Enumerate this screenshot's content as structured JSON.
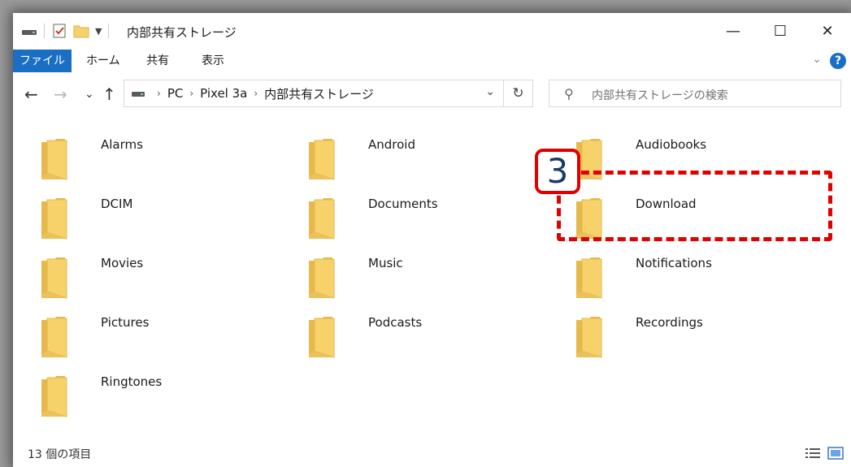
{
  "window": {
    "title": "内部共有ストレージ",
    "controls": {
      "minimize_icon": "—",
      "maximize_icon": "☐",
      "close_icon": "✕"
    }
  },
  "ribbon": {
    "tabs": [
      {
        "label": "ファイル",
        "active": true
      },
      {
        "label": "ホーム"
      },
      {
        "label": "共有"
      },
      {
        "label": "表示"
      }
    ],
    "help_label": "?",
    "accent_color": "#1a6fc4"
  },
  "nav": {
    "back_icon": "←",
    "forward_icon": "→",
    "recent_icon": "⌄",
    "up_icon": "↑",
    "breadcrumb": [
      "PC",
      "Pixel 3a",
      "内部共有ストレージ"
    ],
    "refresh_icon": "↻",
    "search_placeholder": "内部共有ストレージの検索"
  },
  "folders": [
    "Alarms",
    "Android",
    "Audiobooks",
    "DCIM",
    "Documents",
    "Download",
    "Movies",
    "Music",
    "Notifications",
    "Pictures",
    "Podcasts",
    "Recordings",
    "Ringtones"
  ],
  "folder_color": "#f7d26a",
  "status": {
    "item_count": "13 個の項目"
  },
  "annotation": {
    "number": "3",
    "target": "Download",
    "color": "#e00000"
  }
}
